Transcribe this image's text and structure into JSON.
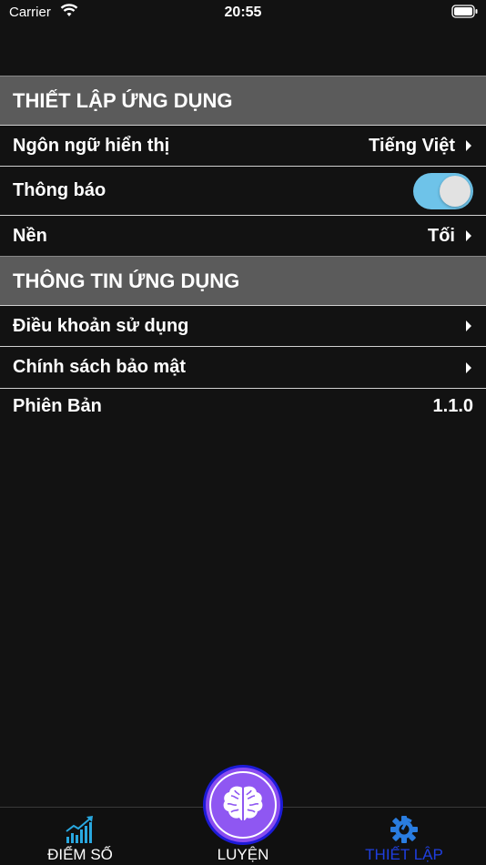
{
  "status_bar": {
    "carrier": "Carrier",
    "time": "20:55"
  },
  "app_settings": {
    "header": "THIẾT LẬP ỨNG DỤNG",
    "language_label": "Ngôn ngữ hiển thị",
    "language_value": "Tiếng Việt",
    "notifications_label": "Thông báo",
    "notifications_on": true,
    "theme_label": "Nền",
    "theme_value": "Tối"
  },
  "app_info": {
    "header": "THÔNG TIN ỨNG DỤNG",
    "terms_label": "Điều khoản sử dụng",
    "privacy_label": "Chính sách bảo mật",
    "version_label": "Phiên Bản",
    "version_value": "1.1.0"
  },
  "tab_bar": {
    "scores_label": "ĐIỂM SỐ",
    "practice_label": "LUYỆN",
    "settings_label": "THIẾT LẬP",
    "active_tab": "settings"
  },
  "colors": {
    "toggle_on": "#6ec3e9",
    "active_tab": "#1f3fe0",
    "practice_button": "#8a4cf0",
    "scores_icon": "#29a8e0"
  },
  "icons": {
    "scores": "chart-growth-icon",
    "practice": "brain-icon",
    "settings": "gear-check-icon"
  }
}
